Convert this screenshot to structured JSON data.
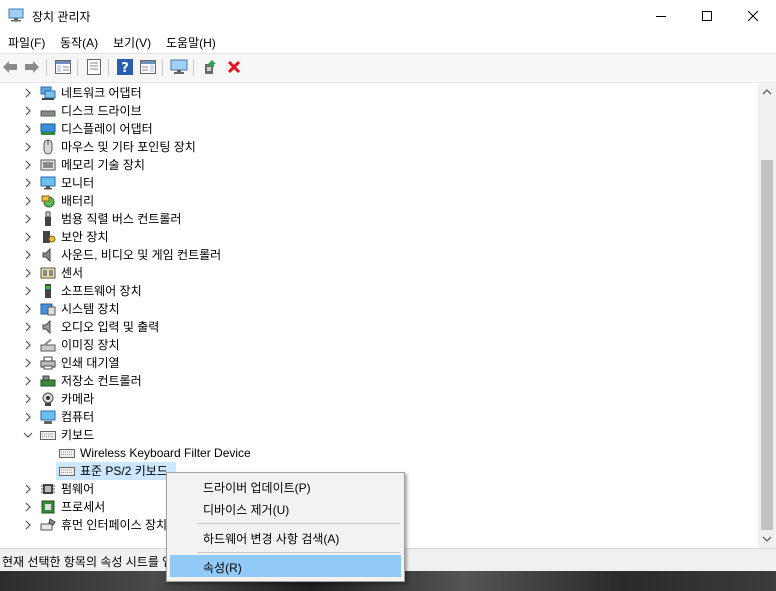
{
  "window": {
    "title": "장치 관리자",
    "minimize_glyph": "—",
    "maximize_glyph": "☐",
    "close_glyph": "✕"
  },
  "menu": [
    "파일(F)",
    "동작(A)",
    "보기(V)",
    "도움말(H)"
  ],
  "toolbar": {
    "icons": [
      "back-arrow-icon",
      "forward-arrow-icon",
      "show-hide-console-tree-icon",
      "properties-icon",
      "help-icon",
      "action-pane-icon",
      "scan-hardware-icon",
      "update-driver-icon",
      "uninstall-device-icon"
    ],
    "uninstall_color": "#e81123"
  },
  "tree": {
    "items": [
      {
        "label": "네트워크 어댑터",
        "icon": "network-adapter-icon",
        "expanded": false
      },
      {
        "label": "디스크 드라이브",
        "icon": "disk-drive-icon",
        "expanded": false
      },
      {
        "label": "디스플레이 어댑터",
        "icon": "display-adapter-icon",
        "expanded": false
      },
      {
        "label": "마우스 및 기타 포인팅 장치",
        "icon": "mouse-icon",
        "expanded": false
      },
      {
        "label": "메모리 기술 장치",
        "icon": "memory-icon",
        "expanded": false
      },
      {
        "label": "모니터",
        "icon": "monitor-icon",
        "expanded": false
      },
      {
        "label": "배터리",
        "icon": "battery-icon",
        "expanded": false
      },
      {
        "label": "범용 직렬 버스 컨트롤러",
        "icon": "usb-icon",
        "expanded": false
      },
      {
        "label": "보안 장치",
        "icon": "security-device-icon",
        "expanded": false
      },
      {
        "label": "사운드, 비디오 및 게임 컨트롤러",
        "icon": "sound-icon",
        "expanded": false
      },
      {
        "label": "센서",
        "icon": "sensor-icon",
        "expanded": false
      },
      {
        "label": "소프트웨어 장치",
        "icon": "software-device-icon",
        "expanded": false
      },
      {
        "label": "시스템 장치",
        "icon": "system-device-icon",
        "expanded": false
      },
      {
        "label": "오디오 입력 및 출력",
        "icon": "audio-icon",
        "expanded": false
      },
      {
        "label": "이미징 장치",
        "icon": "imaging-icon",
        "expanded": false
      },
      {
        "label": "인쇄 대기열",
        "icon": "printer-icon",
        "expanded": false
      },
      {
        "label": "저장소 컨트롤러",
        "icon": "storage-controller-icon",
        "expanded": false
      },
      {
        "label": "카메라",
        "icon": "camera-icon",
        "expanded": false
      },
      {
        "label": "컴퓨터",
        "icon": "computer-icon",
        "expanded": false
      },
      {
        "label": "키보드",
        "icon": "keyboard-icon",
        "expanded": true,
        "children": [
          {
            "label": "Wireless Keyboard Filter Device",
            "icon": "keyboard-icon",
            "selected": false
          },
          {
            "label": "표준 PS/2 키보드",
            "icon": "keyboard-icon",
            "selected": true
          }
        ]
      },
      {
        "label": "펌웨어",
        "icon": "firmware-icon",
        "expanded": false
      },
      {
        "label": "프로세서",
        "icon": "processor-icon",
        "expanded": false
      },
      {
        "label": "휴먼 인터페이스 장치",
        "icon": "hid-icon",
        "expanded": false
      }
    ]
  },
  "context_menu": {
    "items": [
      {
        "label": "드라이버 업데이트(P)",
        "highlighted": false
      },
      {
        "label": "디바이스 제거(U)",
        "highlighted": false
      },
      {
        "label": "하드웨어 변경 사항 검색(A)",
        "highlighted": false
      },
      {
        "label": "속성(R)",
        "highlighted": true
      }
    ]
  },
  "status": {
    "text": "현재 선택한 항목의 속성 시트를 엽니다."
  },
  "colors": {
    "selection": "#cce8ff",
    "menu_highlight": "#91c9f7"
  }
}
